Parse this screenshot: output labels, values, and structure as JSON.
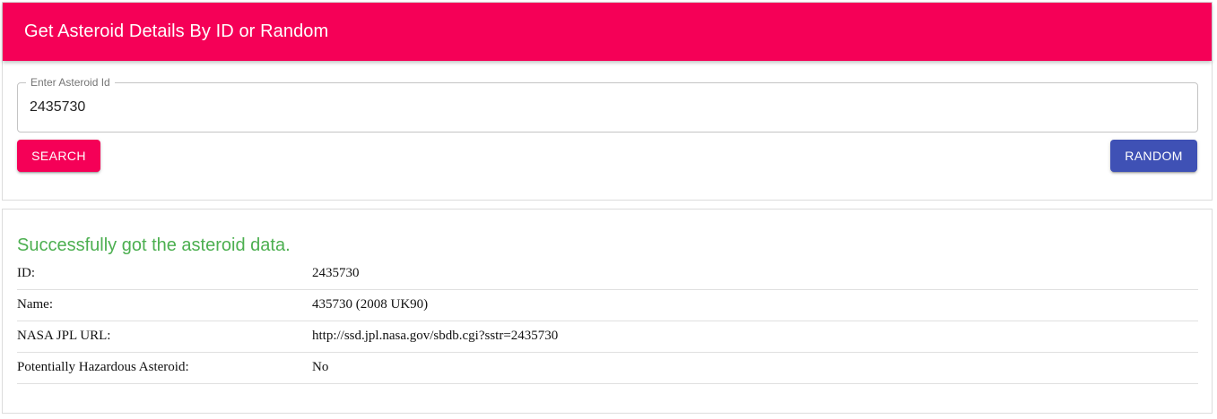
{
  "header": {
    "title": "Get Asteroid Details By ID or Random",
    "color": "#f50057"
  },
  "search": {
    "label": "Enter Asteroid Id",
    "value": "2435730",
    "search_label": "SEARCH",
    "random_label": "RANDOM",
    "search_color": "#f50057",
    "random_color": "#3f51b5"
  },
  "result": {
    "message": "Successfully got the asteroid data.",
    "message_color": "#4caf50",
    "rows": [
      {
        "label": "ID:",
        "value": "2435730"
      },
      {
        "label": "Name:",
        "value": "435730 (2008 UK90)"
      },
      {
        "label": "NASA JPL URL:",
        "value": "http://ssd.jpl.nasa.gov/sbdb.cgi?sstr=2435730"
      },
      {
        "label": "Potentially Hazardous Asteroid:",
        "value": "No"
      }
    ]
  }
}
